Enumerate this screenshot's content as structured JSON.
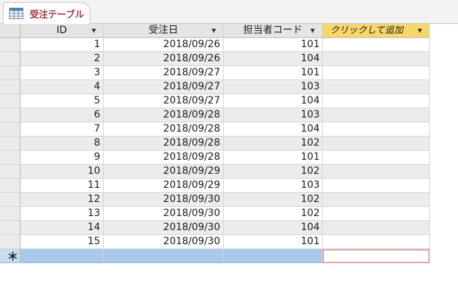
{
  "tab": {
    "label": "受注テーブル",
    "icon": "table-icon",
    "accent": "#a5373c"
  },
  "columns": [
    {
      "label": "ID",
      "icon": "sort-filter-icon"
    },
    {
      "label": "受注日",
      "icon": "dropdown-icon"
    },
    {
      "label": "担当者コード",
      "icon": "dropdown-icon"
    },
    {
      "label": "クリックして追加",
      "icon": "dropdown-icon"
    }
  ],
  "rows": [
    {
      "id": "1",
      "date": "2018/09/26",
      "staff": "101"
    },
    {
      "id": "2",
      "date": "2018/09/26",
      "staff": "104"
    },
    {
      "id": "3",
      "date": "2018/09/27",
      "staff": "101"
    },
    {
      "id": "4",
      "date": "2018/09/27",
      "staff": "103"
    },
    {
      "id": "5",
      "date": "2018/09/27",
      "staff": "104"
    },
    {
      "id": "6",
      "date": "2018/09/28",
      "staff": "103"
    },
    {
      "id": "7",
      "date": "2018/09/28",
      "staff": "104"
    },
    {
      "id": "8",
      "date": "2018/09/28",
      "staff": "102"
    },
    {
      "id": "9",
      "date": "2018/09/28",
      "staff": "101"
    },
    {
      "id": "10",
      "date": "2018/09/29",
      "staff": "102"
    },
    {
      "id": "11",
      "date": "2018/09/29",
      "staff": "103"
    },
    {
      "id": "12",
      "date": "2018/09/30",
      "staff": "102"
    },
    {
      "id": "13",
      "date": "2018/09/30",
      "staff": "102"
    },
    {
      "id": "14",
      "date": "2018/09/30",
      "staff": "104"
    },
    {
      "id": "15",
      "date": "2018/09/30",
      "staff": "101"
    }
  ],
  "new_record_marker": "＊"
}
